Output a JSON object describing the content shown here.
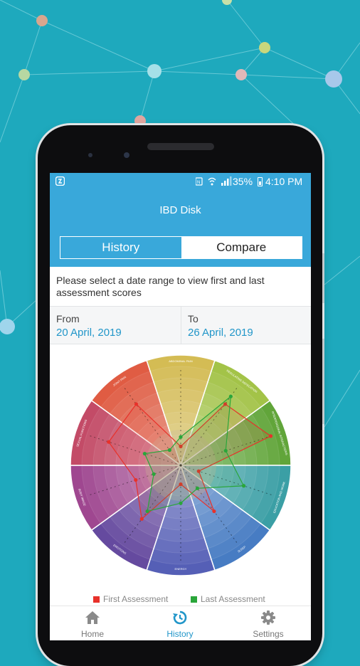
{
  "status_bar": {
    "battery": "35%",
    "time": "4:10 PM"
  },
  "app": {
    "title": "IBD Disk"
  },
  "tabs": [
    {
      "label": "History",
      "active": true
    },
    {
      "label": "Compare",
      "active": false
    }
  ],
  "instructions": "Please select a date range to view first and last assessment scores",
  "date_range": {
    "from_label": "From",
    "from_value": "20 April, 2019",
    "to_label": "To",
    "to_value": "26 April, 2019"
  },
  "disk": {
    "sector_labels": [
      "ABDOMINAL PAIN",
      "REGULATING DEFECATION",
      "INTERPERSONAL INTERACTIONS",
      "EDUCATION AND WORK",
      "SLEEP",
      "ENERGY",
      "EMOTIONS",
      "BODY IMAGE",
      "SEXUAL FUNCTIONS",
      "JOINT PAIN"
    ],
    "sector_colors": [
      "#d2b84a",
      "#9ec03d",
      "#58a02e",
      "#2f9aa0",
      "#3c74c0",
      "#4b55b2",
      "#5c3f9a",
      "#9a3c8a",
      "#c0405e",
      "#df5238"
    ],
    "scale_max": 10,
    "series": [
      {
        "name": "First Assessment",
        "color": "#e8312a",
        "values": [
          2,
          8,
          10,
          2,
          6,
          2,
          7,
          5,
          8,
          8
        ]
      },
      {
        "name": "Last Assessment",
        "color": "#2aa63a",
        "values": [
          3,
          9,
          5,
          7,
          3,
          4,
          6,
          3,
          4,
          2
        ]
      }
    ]
  },
  "legend": [
    {
      "label": "First Assessment",
      "color": "#e8312a"
    },
    {
      "label": "Last Assessment",
      "color": "#2aa63a"
    }
  ],
  "nav": [
    {
      "label": "Home",
      "icon": "home-icon"
    },
    {
      "label": "History",
      "icon": "history-icon",
      "active": true
    },
    {
      "label": "Settings",
      "icon": "gear-icon"
    }
  ]
}
